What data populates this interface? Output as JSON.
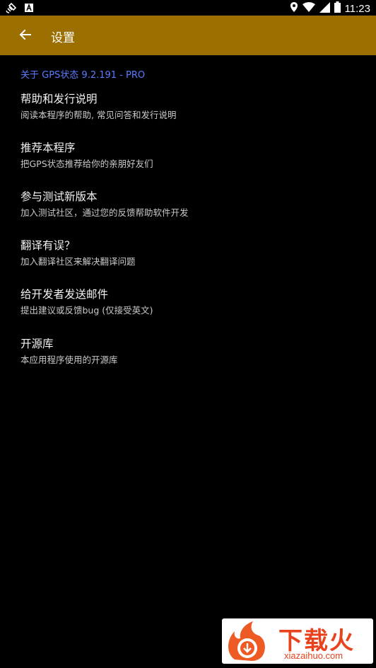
{
  "status_bar": {
    "time": "11:23",
    "icons": [
      "satellite-icon",
      "notification-a-icon",
      "location-icon",
      "wifi-icon",
      "signal-icon",
      "battery-icon"
    ]
  },
  "toolbar": {
    "title": "设置",
    "back_icon": "arrow-left-icon",
    "color": "#9b7001"
  },
  "about": {
    "header": "关于 GPS状态 9.2.191  - PRO",
    "color": "#5c7cff"
  },
  "items": [
    {
      "title": "帮助和发行说明",
      "summary": "阅读本程序的帮助, 常见问答和发行说明"
    },
    {
      "title": "推荐本程序",
      "summary": "把GPS状态推荐给你的亲朋好友们"
    },
    {
      "title": "参与测试新版本",
      "summary": "加入测试社区，通过您的反馈帮助软件开发"
    },
    {
      "title": "翻译有误？",
      "summary": "加入翻译社区来解决翻译问题"
    },
    {
      "title": "给开发者发送邮件",
      "summary": "提出建议或反馈bug (仅接受英文)"
    },
    {
      "title": "开源库",
      "summary": "本应用程序使用的开源库"
    }
  ],
  "watermark": {
    "text": "下载火",
    "subtext": "xiazaihuo.com"
  }
}
